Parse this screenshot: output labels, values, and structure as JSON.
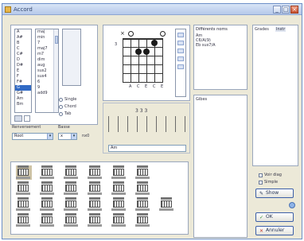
{
  "window": {
    "title": "Accord"
  },
  "titlebar": {
    "minimize": "_",
    "maximize": "□",
    "close": "×"
  },
  "root_list": {
    "items": [
      "A",
      "A#",
      "B",
      "C",
      "C#",
      "D",
      "D#",
      "E",
      "F",
      "F#",
      "G",
      "G#",
      "Am",
      "Bm"
    ],
    "selected_index": 10
  },
  "type_list": {
    "items": [
      "maj",
      "min",
      "7",
      "maj7",
      "m7",
      "dim",
      "aug",
      "sus2",
      "sus4",
      "6",
      "9",
      "add9"
    ]
  },
  "mode_list": {
    "items": [
      "",
      "",
      "",
      "",
      ""
    ]
  },
  "radios": [
    "Single",
    "Chord",
    "Tab"
  ],
  "controls": {
    "left_label": "Renversement",
    "right_label": "Basse",
    "left_value": "Root",
    "right_value": "x",
    "extra_text": "nx0"
  },
  "fretboard": {
    "strings": 6,
    "frets": 5,
    "open_strings": [
      1,
      5
    ],
    "muted_strings": [
      0
    ],
    "fingers": [
      {
        "string": 2,
        "fret": 2
      },
      {
        "string": 3,
        "fret": 2
      },
      {
        "string": 4,
        "fret": 1
      }
    ],
    "bottom_labels": [
      "A",
      "C",
      "E",
      "C",
      "E"
    ],
    "fret_number": "3"
  },
  "notes_row": {
    "header": "3  3  3",
    "text": "Am"
  },
  "right_panes": {
    "top_title": "Différents noms",
    "top_items": [
      "Am",
      "C6/A(9)",
      "Eb sus7/A"
    ],
    "mid_title": "Gibes",
    "side_title": "Grades",
    "side_header": "Instr"
  },
  "checks": [
    "Voir diag",
    "Simple"
  ],
  "buttons": {
    "show": "Show",
    "ok": "OK",
    "cancel": "Annuler"
  },
  "chords_grid": {
    "rows": 4,
    "cols": 6,
    "extra_tile": true
  }
}
